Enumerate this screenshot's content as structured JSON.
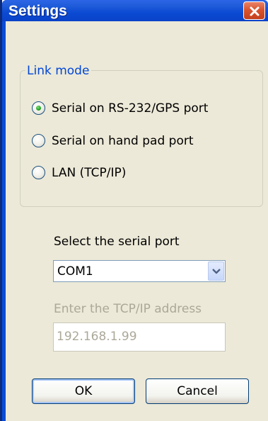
{
  "window": {
    "title": "Settings",
    "colors": {
      "titlebar": "#0a4bd8",
      "client_background": "#ece9d8",
      "group_title": "#0046d5",
      "close_button": "#d8552f",
      "disabled_text": "#aca899"
    }
  },
  "link_mode": {
    "title": "Link mode",
    "options": [
      {
        "label": "Serial on RS-232/GPS port",
        "selected": true
      },
      {
        "label": "Serial on hand pad port",
        "selected": false
      },
      {
        "label": "LAN (TCP/IP)",
        "selected": false
      }
    ]
  },
  "serial_port": {
    "label": "Select the serial port",
    "value": "COM1"
  },
  "tcpip": {
    "label": "Enter the TCP/IP address",
    "value": "192.168.1.99",
    "disabled": true
  },
  "buttons": {
    "ok": "OK",
    "cancel": "Cancel"
  },
  "icons": {
    "close": "close-icon",
    "dropdown": "chevron-down-icon",
    "radio": "radio-icon"
  }
}
